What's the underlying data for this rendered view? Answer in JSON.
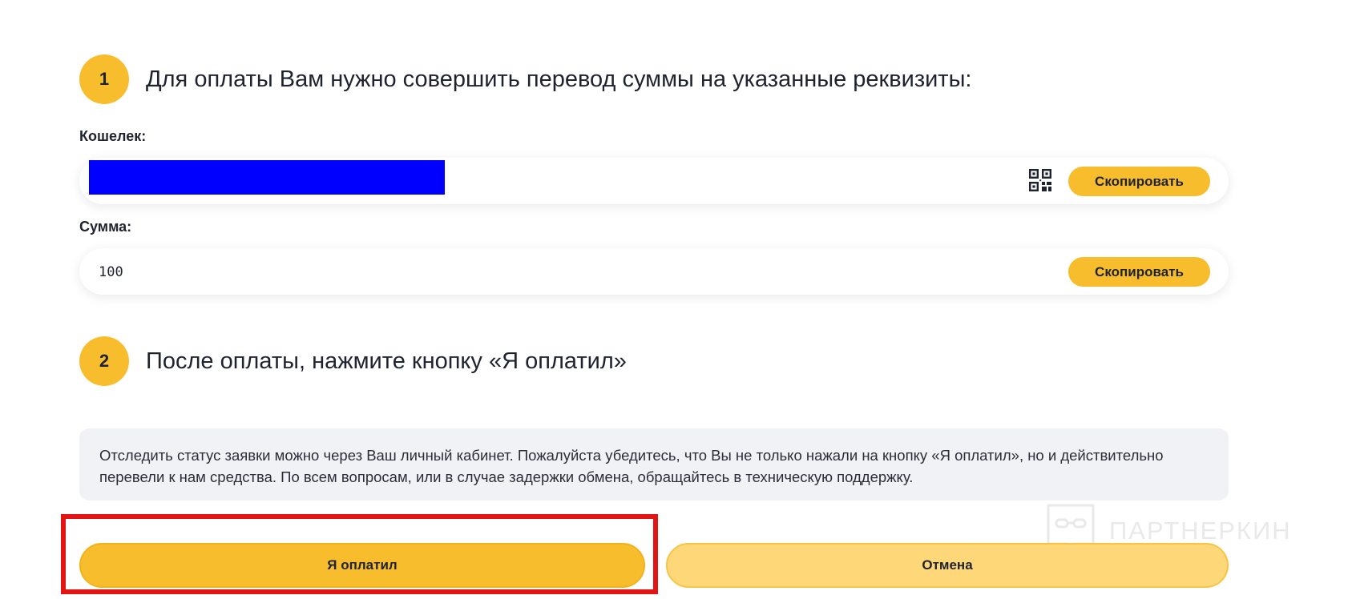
{
  "step1": {
    "number": "1",
    "text": "Для оплаты Вам нужно совершить перевод суммы на указанные реквизиты:"
  },
  "wallet": {
    "label": "Кошелек:",
    "copy_label": "Скопировать",
    "qr_icon": "qr-code-icon"
  },
  "amount": {
    "label": "Сумма:",
    "value": "100",
    "copy_label": "Скопировать"
  },
  "step2": {
    "number": "2",
    "text": "После оплаты, нажмите кнопку «Я оплатил»"
  },
  "notice": {
    "text": "Отследить статус заявки можно через Ваш личный кабинет. Пожалуйста убедитесь, что Вы не только нажали на кнопку «Я оплатил», но и действительно перевели к нам средства. По всем вопросам, или в случае задержки обмена, обращайтесь в техническую поддержку."
  },
  "actions": {
    "paid_label": "Я оплатил",
    "cancel_label": "Отмена"
  },
  "watermark": {
    "text": "ПАРТНЕРКИН"
  },
  "colors": {
    "accent": "#f7bd2d",
    "accent_light": "#fdd778",
    "highlight": "#e41414",
    "redaction": "#0000ff",
    "notice_bg": "#f1f2f6"
  }
}
